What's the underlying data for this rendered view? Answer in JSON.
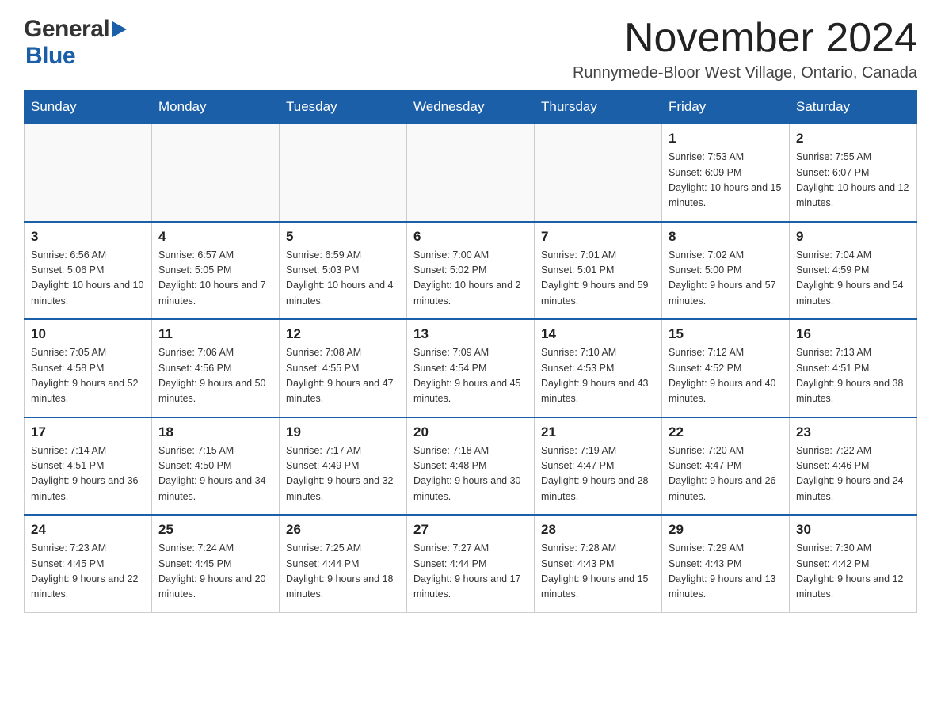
{
  "logo": {
    "general": "General",
    "triangle": "▶",
    "blue": "Blue"
  },
  "header": {
    "month_year": "November 2024",
    "location": "Runnymede-Bloor West Village, Ontario, Canada"
  },
  "weekdays": [
    "Sunday",
    "Monday",
    "Tuesday",
    "Wednesday",
    "Thursday",
    "Friday",
    "Saturday"
  ],
  "weeks": [
    [
      {
        "day": "",
        "sunrise": "",
        "sunset": "",
        "daylight": ""
      },
      {
        "day": "",
        "sunrise": "",
        "sunset": "",
        "daylight": ""
      },
      {
        "day": "",
        "sunrise": "",
        "sunset": "",
        "daylight": ""
      },
      {
        "day": "",
        "sunrise": "",
        "sunset": "",
        "daylight": ""
      },
      {
        "day": "",
        "sunrise": "",
        "sunset": "",
        "daylight": ""
      },
      {
        "day": "1",
        "sunrise": "Sunrise: 7:53 AM",
        "sunset": "Sunset: 6:09 PM",
        "daylight": "Daylight: 10 hours and 15 minutes."
      },
      {
        "day": "2",
        "sunrise": "Sunrise: 7:55 AM",
        "sunset": "Sunset: 6:07 PM",
        "daylight": "Daylight: 10 hours and 12 minutes."
      }
    ],
    [
      {
        "day": "3",
        "sunrise": "Sunrise: 6:56 AM",
        "sunset": "Sunset: 5:06 PM",
        "daylight": "Daylight: 10 hours and 10 minutes."
      },
      {
        "day": "4",
        "sunrise": "Sunrise: 6:57 AM",
        "sunset": "Sunset: 5:05 PM",
        "daylight": "Daylight: 10 hours and 7 minutes."
      },
      {
        "day": "5",
        "sunrise": "Sunrise: 6:59 AM",
        "sunset": "Sunset: 5:03 PM",
        "daylight": "Daylight: 10 hours and 4 minutes."
      },
      {
        "day": "6",
        "sunrise": "Sunrise: 7:00 AM",
        "sunset": "Sunset: 5:02 PM",
        "daylight": "Daylight: 10 hours and 2 minutes."
      },
      {
        "day": "7",
        "sunrise": "Sunrise: 7:01 AM",
        "sunset": "Sunset: 5:01 PM",
        "daylight": "Daylight: 9 hours and 59 minutes."
      },
      {
        "day": "8",
        "sunrise": "Sunrise: 7:02 AM",
        "sunset": "Sunset: 5:00 PM",
        "daylight": "Daylight: 9 hours and 57 minutes."
      },
      {
        "day": "9",
        "sunrise": "Sunrise: 7:04 AM",
        "sunset": "Sunset: 4:59 PM",
        "daylight": "Daylight: 9 hours and 54 minutes."
      }
    ],
    [
      {
        "day": "10",
        "sunrise": "Sunrise: 7:05 AM",
        "sunset": "Sunset: 4:58 PM",
        "daylight": "Daylight: 9 hours and 52 minutes."
      },
      {
        "day": "11",
        "sunrise": "Sunrise: 7:06 AM",
        "sunset": "Sunset: 4:56 PM",
        "daylight": "Daylight: 9 hours and 50 minutes."
      },
      {
        "day": "12",
        "sunrise": "Sunrise: 7:08 AM",
        "sunset": "Sunset: 4:55 PM",
        "daylight": "Daylight: 9 hours and 47 minutes."
      },
      {
        "day": "13",
        "sunrise": "Sunrise: 7:09 AM",
        "sunset": "Sunset: 4:54 PM",
        "daylight": "Daylight: 9 hours and 45 minutes."
      },
      {
        "day": "14",
        "sunrise": "Sunrise: 7:10 AM",
        "sunset": "Sunset: 4:53 PM",
        "daylight": "Daylight: 9 hours and 43 minutes."
      },
      {
        "day": "15",
        "sunrise": "Sunrise: 7:12 AM",
        "sunset": "Sunset: 4:52 PM",
        "daylight": "Daylight: 9 hours and 40 minutes."
      },
      {
        "day": "16",
        "sunrise": "Sunrise: 7:13 AM",
        "sunset": "Sunset: 4:51 PM",
        "daylight": "Daylight: 9 hours and 38 minutes."
      }
    ],
    [
      {
        "day": "17",
        "sunrise": "Sunrise: 7:14 AM",
        "sunset": "Sunset: 4:51 PM",
        "daylight": "Daylight: 9 hours and 36 minutes."
      },
      {
        "day": "18",
        "sunrise": "Sunrise: 7:15 AM",
        "sunset": "Sunset: 4:50 PM",
        "daylight": "Daylight: 9 hours and 34 minutes."
      },
      {
        "day": "19",
        "sunrise": "Sunrise: 7:17 AM",
        "sunset": "Sunset: 4:49 PM",
        "daylight": "Daylight: 9 hours and 32 minutes."
      },
      {
        "day": "20",
        "sunrise": "Sunrise: 7:18 AM",
        "sunset": "Sunset: 4:48 PM",
        "daylight": "Daylight: 9 hours and 30 minutes."
      },
      {
        "day": "21",
        "sunrise": "Sunrise: 7:19 AM",
        "sunset": "Sunset: 4:47 PM",
        "daylight": "Daylight: 9 hours and 28 minutes."
      },
      {
        "day": "22",
        "sunrise": "Sunrise: 7:20 AM",
        "sunset": "Sunset: 4:47 PM",
        "daylight": "Daylight: 9 hours and 26 minutes."
      },
      {
        "day": "23",
        "sunrise": "Sunrise: 7:22 AM",
        "sunset": "Sunset: 4:46 PM",
        "daylight": "Daylight: 9 hours and 24 minutes."
      }
    ],
    [
      {
        "day": "24",
        "sunrise": "Sunrise: 7:23 AM",
        "sunset": "Sunset: 4:45 PM",
        "daylight": "Daylight: 9 hours and 22 minutes."
      },
      {
        "day": "25",
        "sunrise": "Sunrise: 7:24 AM",
        "sunset": "Sunset: 4:45 PM",
        "daylight": "Daylight: 9 hours and 20 minutes."
      },
      {
        "day": "26",
        "sunrise": "Sunrise: 7:25 AM",
        "sunset": "Sunset: 4:44 PM",
        "daylight": "Daylight: 9 hours and 18 minutes."
      },
      {
        "day": "27",
        "sunrise": "Sunrise: 7:27 AM",
        "sunset": "Sunset: 4:44 PM",
        "daylight": "Daylight: 9 hours and 17 minutes."
      },
      {
        "day": "28",
        "sunrise": "Sunrise: 7:28 AM",
        "sunset": "Sunset: 4:43 PM",
        "daylight": "Daylight: 9 hours and 15 minutes."
      },
      {
        "day": "29",
        "sunrise": "Sunrise: 7:29 AM",
        "sunset": "Sunset: 4:43 PM",
        "daylight": "Daylight: 9 hours and 13 minutes."
      },
      {
        "day": "30",
        "sunrise": "Sunrise: 7:30 AM",
        "sunset": "Sunset: 4:42 PM",
        "daylight": "Daylight: 9 hours and 12 minutes."
      }
    ]
  ]
}
